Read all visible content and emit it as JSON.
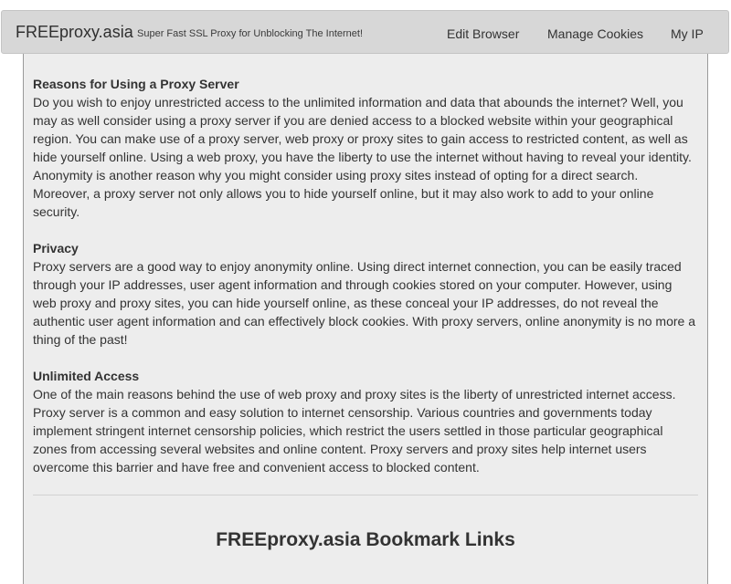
{
  "header": {
    "brand": "FREEproxy.asia",
    "tagline": "Super Fast SSL Proxy for Unblocking The Internet!",
    "nav": {
      "edit_browser": "Edit Browser",
      "manage_cookies": "Manage Cookies",
      "my_ip": "My IP"
    }
  },
  "sections": [
    {
      "heading": "Reasons for Using a Proxy Server",
      "body": "Do you wish to enjoy unrestricted access to the unlimited information and data that abounds the internet? Well, you may as well consider using a proxy server if you are denied access to a blocked website within your geographical region. You can make use of a proxy server, web proxy or proxy sites to gain access to restricted content, as well as hide yourself online. Using a web proxy, you have the liberty to use the internet without having to reveal your identity. Anonymity is another reason why you might consider using proxy sites instead of opting for a direct search. Moreover, a proxy server not only allows you to hide yourself online, but it may also work to add to your online security."
    },
    {
      "heading": "Privacy",
      "body": "Proxy servers are a good way to enjoy anonymity online. Using direct internet connection, you can be easily traced through your IP addresses, user agent information and through cookies stored on your computer. However, using web proxy and proxy sites, you can hide yourself online, as these conceal your IP addresses, do not reveal the authentic user agent information and can effectively block cookies. With proxy servers, online anonymity is no more a thing of the past!"
    },
    {
      "heading": "Unlimited Access",
      "body": "One of the main reasons behind the use of web proxy and proxy sites is the liberty of unrestricted internet access. Proxy server is a common and easy solution to internet censorship. Various countries and governments today implement stringent internet censorship policies, which restrict the users settled in those particular geographical zones from accessing several websites and online content. Proxy servers and proxy sites help internet users overcome this barrier and have free and convenient access to blocked content."
    }
  ],
  "bookmarks": {
    "title": "FREEproxy.asia Bookmark Links"
  }
}
